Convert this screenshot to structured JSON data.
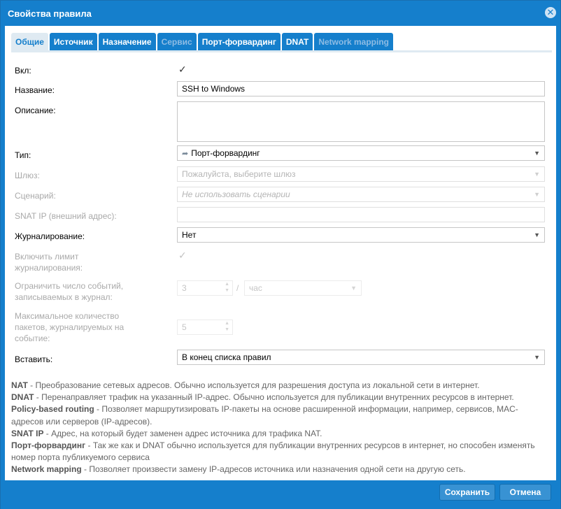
{
  "dialog": {
    "title": "Свойства правила",
    "close_glyph": "✕"
  },
  "tabs": [
    {
      "label": "Общие",
      "state": "active"
    },
    {
      "label": "Источник",
      "state": "normal"
    },
    {
      "label": "Назначение",
      "state": "normal"
    },
    {
      "label": "Сервис",
      "state": "disabled"
    },
    {
      "label": "Порт-форвардинг",
      "state": "normal"
    },
    {
      "label": "DNAT",
      "state": "normal"
    },
    {
      "label": "Network mapping",
      "state": "disabled"
    }
  ],
  "form": {
    "enabled_label": "Вкл:",
    "enabled_checked": true,
    "name_label": "Название:",
    "name_value": "SSH to Windows",
    "description_label": "Описание:",
    "description_value": "",
    "type_label": "Тип:",
    "type_value": "Порт-форвардинг",
    "type_icon": "share-arrow-icon",
    "gateway_label": "Шлюз:",
    "gateway_placeholder": "Пожалуйста, выберите шлюз",
    "scenario_label": "Сценарий:",
    "scenario_placeholder": "Не использовать сценарии",
    "snat_label": "SNAT IP (внешний адрес):",
    "snat_value": "",
    "logging_label": "Журналирование:",
    "logging_value": "Нет",
    "limit_label_1": "Включить лимит",
    "limit_label_2": "журналирования:",
    "limit_checked": true,
    "events_label_1": "Ограничить число событий,",
    "events_label_2": "записываемых в журнал:",
    "events_count": "3",
    "events_sep": "/",
    "events_unit": "час",
    "packets_label_1": "Максимальное количество",
    "packets_label_2": "пакетов, журналируемых на",
    "packets_label_3": "событие:",
    "packets_count": "5",
    "insert_label": "Вставить:",
    "insert_value": "В конец списка правил"
  },
  "help": [
    {
      "term": "NAT",
      "text": " - Преобразование сетевых адресов. Обычно используется для разрешения доступа из локальной сети в интернет."
    },
    {
      "term": "DNAT",
      "text": " - Перенаправляет трафик на указанный IP-адрес. Обычно используется для публикации внутренних ресурсов в интернет."
    },
    {
      "term": "Policy-based routing",
      "text": " - Позволяет маршрутизировать IP-пакеты на основе расширенной информации, например, сервисов, MAC-адресов или серверов (IP-адресов)."
    },
    {
      "term": "SNAT IP",
      "text": " - Адрес, на который будет заменен адрес источника для трафика NAT."
    },
    {
      "term": "Порт-форвардинг",
      "text": " - Так же как и DNAT обычно используется для публикации внутренних ресурсов в интернет, но способен изменять номер порта публикуемого сервиса"
    },
    {
      "term": "Network mapping",
      "text": " - Позволяет произвести замену IP-адресов источника или назначения одной сети на другую сеть."
    }
  ],
  "footer": {
    "save_label": "Сохранить",
    "cancel_label": "Отмена"
  },
  "colors": {
    "accent": "#157fcc",
    "tab_active_bg": "#dfeaf2",
    "disabled_text": "#a9a9a9"
  }
}
